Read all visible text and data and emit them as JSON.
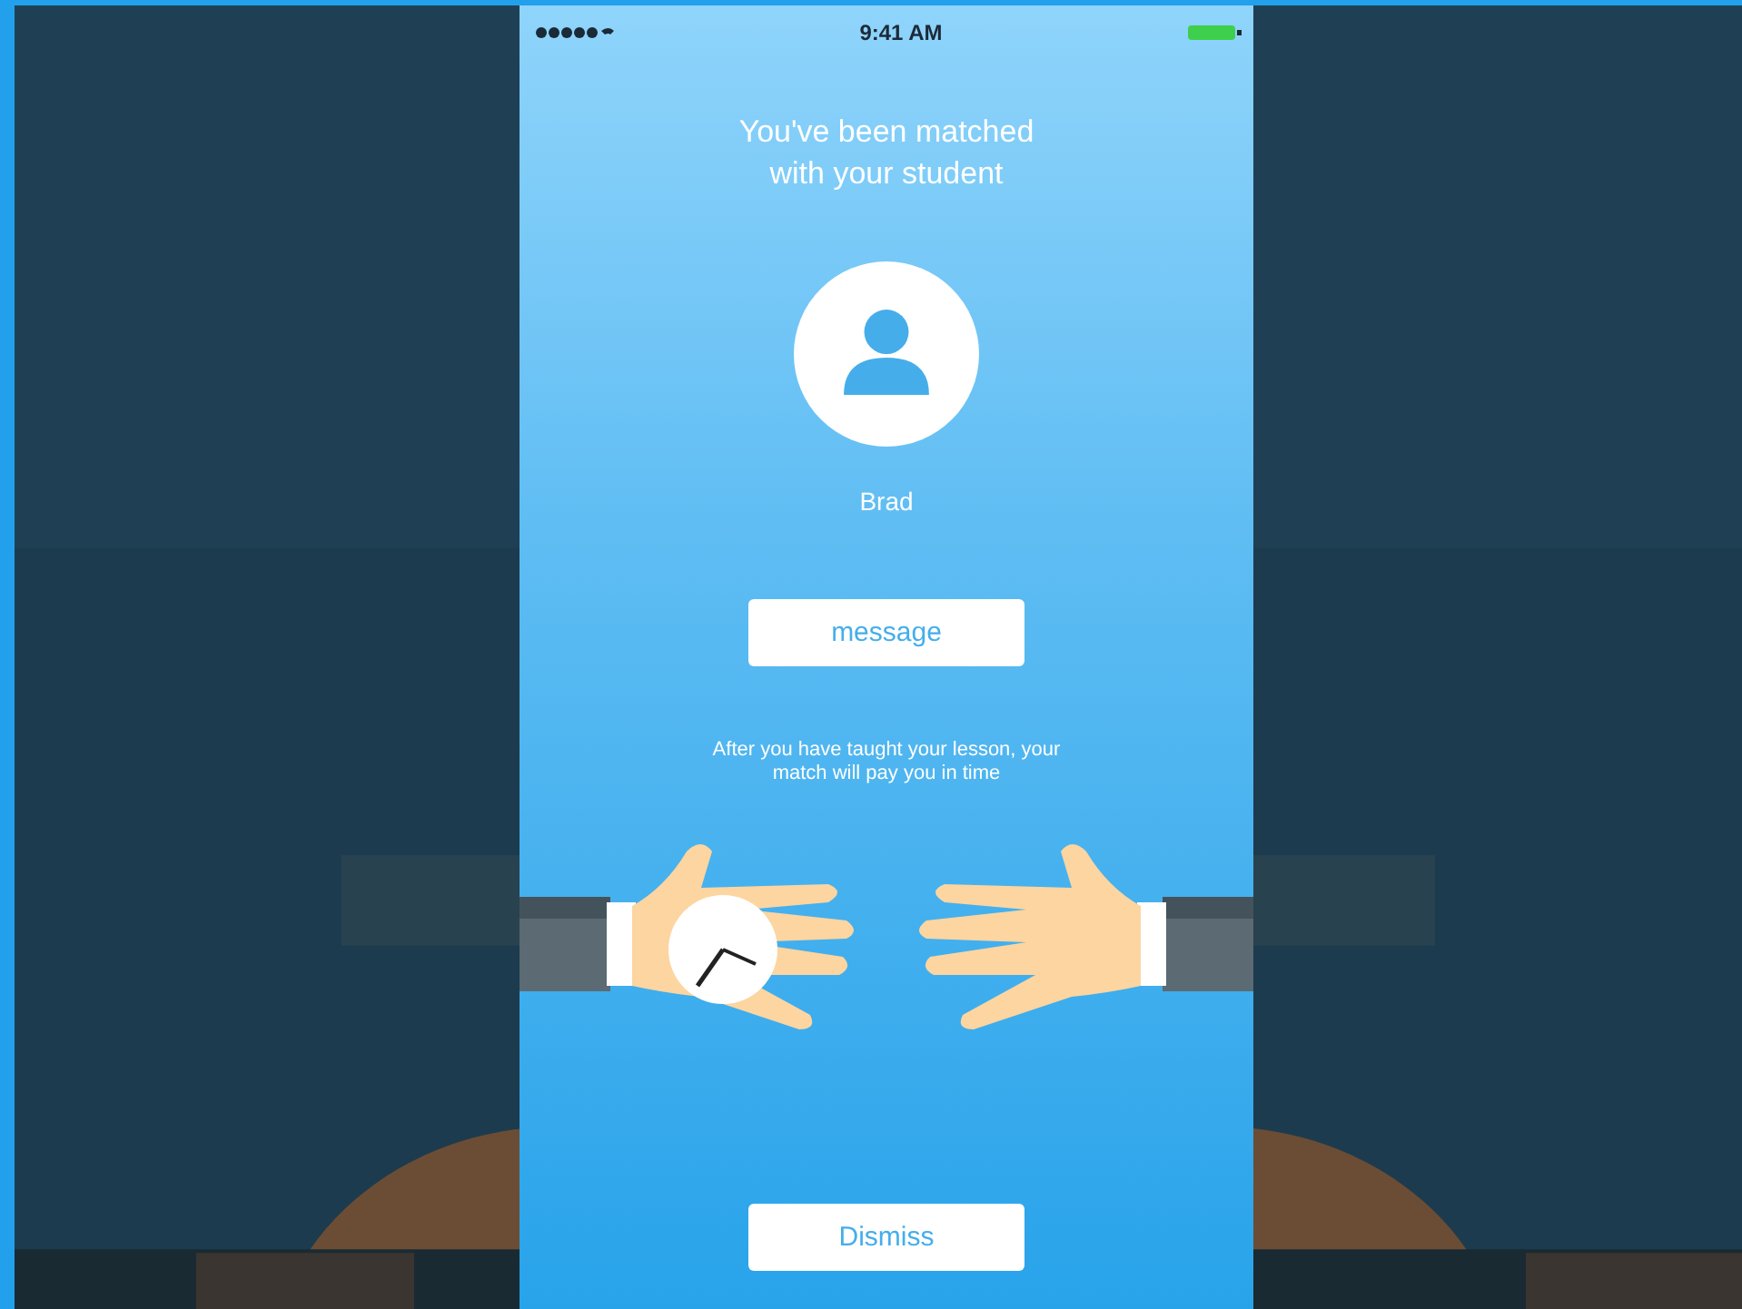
{
  "status_bar": {
    "time": "9:41 AM"
  },
  "heading": "You've been matched with your student",
  "student": {
    "name": "Brad"
  },
  "message_button": "message",
  "note": "After you have taught your lesson, your match will pay you in time",
  "dismiss_button": "Dismiss"
}
